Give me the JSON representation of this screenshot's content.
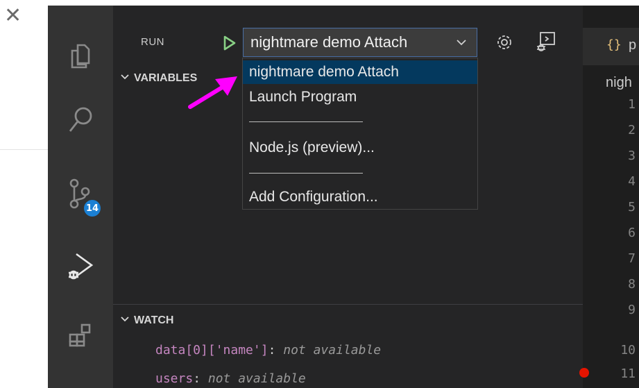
{
  "window": {
    "close_glyph": "✕"
  },
  "activity_bar": {
    "icons": [
      "explorer-icon",
      "search-icon",
      "source-control-icon",
      "run-debug-icon",
      "extensions-icon"
    ],
    "source_control_badge": "14"
  },
  "run_panel": {
    "title": "RUN",
    "selected_configuration": "nightmare demo Attach"
  },
  "dropdown": {
    "items": [
      "nightmare demo Attach",
      "Launch Program",
      "Node.js (preview)...",
      "Add Configuration..."
    ],
    "separator": "—————"
  },
  "sections": {
    "variables": "VARIABLES",
    "watch": "WATCH"
  },
  "watch": [
    {
      "name": "data[0]['name']",
      "value": "not available"
    },
    {
      "name": "users",
      "value": "not available"
    }
  ],
  "editor": {
    "tab_label": "p",
    "breadcrumb": "nigh",
    "line_numbers": [
      "1",
      "2",
      "3",
      "4",
      "5",
      "6",
      "7",
      "8",
      "9",
      "10",
      "11"
    ]
  },
  "colors": {
    "accent": "#1b80d4",
    "play": "#89d185",
    "arrow": "#ff00ff",
    "breakpoint": "#e51400",
    "watch_name": "#c586c0"
  }
}
